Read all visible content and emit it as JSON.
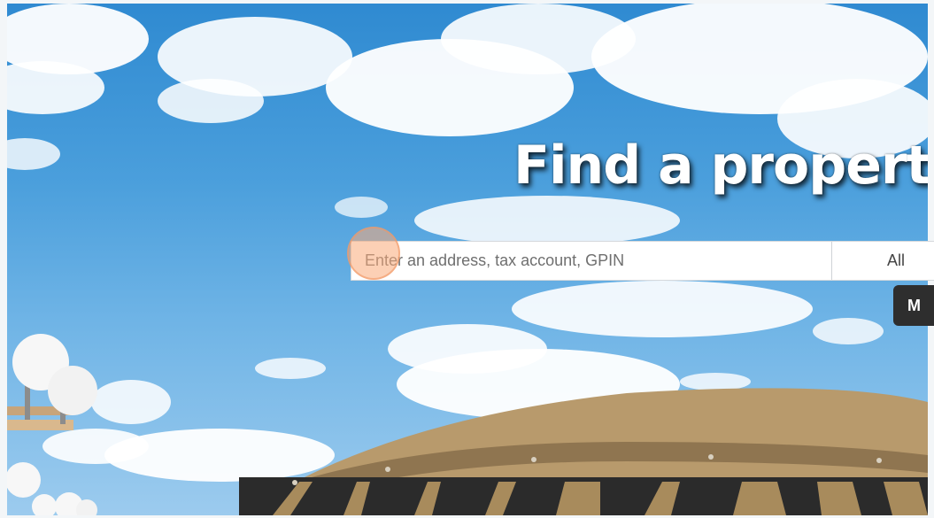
{
  "hero": {
    "headline": "Find a property"
  },
  "search": {
    "placeholder": "Enter an address, tax account, GPIN",
    "value": "",
    "scope_selected": "All"
  },
  "side_button": {
    "label": "M"
  },
  "colors": {
    "sky_top": "#2f8ad1",
    "sky_bottom": "#9ccbee",
    "dome": "#b89a6c",
    "headline_text": "#ffffff",
    "dark_button": "#2e2e2e",
    "click_marker": "#f9aa78"
  },
  "icons": {
    "click_marker": "click-indicator-circle"
  }
}
